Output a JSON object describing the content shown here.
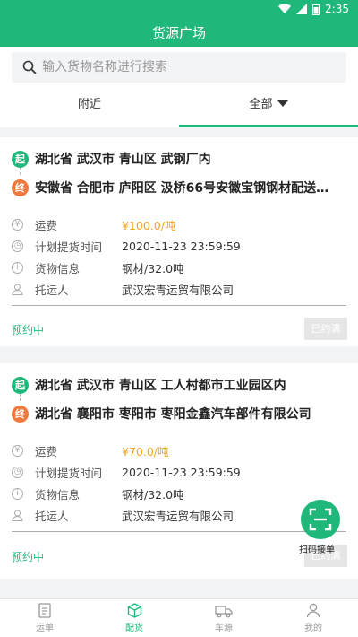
{
  "status_bar": {
    "time": "2:35"
  },
  "header": {
    "title": "货源广场"
  },
  "search": {
    "placeholder": "输入货物名称进行搜索"
  },
  "tabs": [
    {
      "label": "附近",
      "active": false
    },
    {
      "label": "全部",
      "active": true
    }
  ],
  "labels": {
    "start_badge": "起",
    "end_badge": "终",
    "freight": "运费",
    "pickup_time": "计划提货时间",
    "cargo_info": "货物信息",
    "shipper": "托运人"
  },
  "cards": [
    {
      "origin": "湖北省 武汉市 青山区 武钢厂内",
      "destination": "安徽省 合肥市 庐阳区 汲桥66号安徽宝钢钢材配送…",
      "freight": "¥100.0/吨",
      "pickup_time": "2020-11-23 23:59:59",
      "cargo_info": "钢材/32.0吨",
      "shipper": "武汉宏青运贸有限公司",
      "status": "预约中",
      "action": "已约满"
    },
    {
      "origin": "湖北省 武汉市 青山区 工人村都市工业园区内",
      "destination": "湖北省 襄阳市 枣阳市 枣阳金鑫汽车部件有限公司",
      "freight": "¥70.0/吨",
      "pickup_time": "2020-11-23 23:59:59",
      "cargo_info": "钢材/32.0吨",
      "shipper": "武汉宏青运贸有限公司",
      "status": "预约中",
      "action": "已约满"
    }
  ],
  "scan": {
    "label": "扫码接单"
  },
  "bottom_nav": [
    {
      "label": "运单",
      "icon": "document-icon",
      "active": false
    },
    {
      "label": "配货",
      "icon": "box-icon",
      "active": true
    },
    {
      "label": "车源",
      "icon": "truck-icon",
      "active": false
    },
    {
      "label": "我的",
      "icon": "person-icon",
      "active": false
    }
  ],
  "colors": {
    "brand": "#1fb87a",
    "price": "#f6a623",
    "end_badge": "#f07a3e"
  }
}
